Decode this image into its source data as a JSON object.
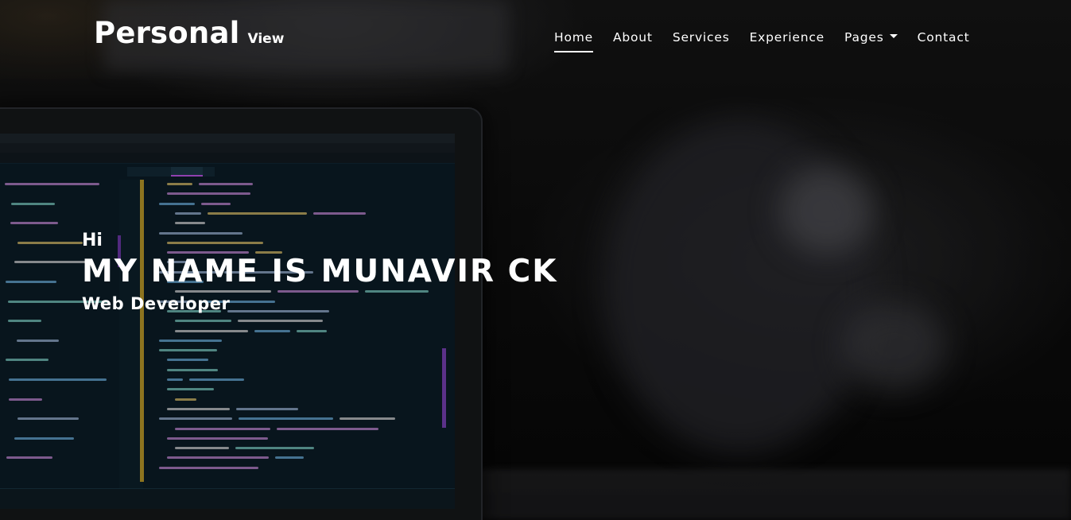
{
  "brand": {
    "main": "Personal",
    "sub": "View"
  },
  "nav": {
    "items": [
      {
        "label": "Home",
        "active": true
      },
      {
        "label": "About",
        "active": false
      },
      {
        "label": "Services",
        "active": false
      },
      {
        "label": "Experience",
        "active": false
      },
      {
        "label": "Pages",
        "active": false,
        "dropdown": true
      },
      {
        "label": "Contact",
        "active": false
      }
    ]
  },
  "hero": {
    "greeting": "Hi",
    "headline": "MY NAME IS MUNAVIR CK",
    "role": "Web Developer",
    "background_image": "laptop-with-code-editor-photo"
  },
  "colors": {
    "text": "#ffffff",
    "background": "#0b0b0b",
    "code_accent": "#c9a227",
    "editor_accent": "#8a45c9"
  }
}
